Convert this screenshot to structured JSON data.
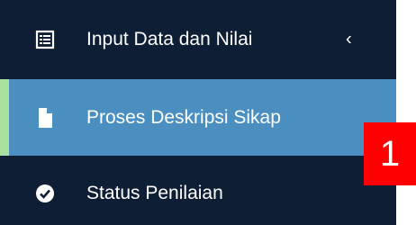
{
  "sidebar": {
    "items": [
      {
        "label": "Input Data dan Nilai",
        "icon": "table-list-icon",
        "has_submenu": true,
        "active": false
      },
      {
        "label": "Proses Deskripsi Sikap",
        "icon": "file-icon",
        "active": true
      },
      {
        "label": "Status Penilaian",
        "icon": "check-circle-icon",
        "active": false
      }
    ]
  },
  "badge": {
    "text": "1"
  },
  "colors": {
    "sidebar_bg": "#0d1e35",
    "active_bg": "#4a8fbf",
    "active_accent": "#a8e0a0",
    "badge_bg": "#ff0000"
  }
}
